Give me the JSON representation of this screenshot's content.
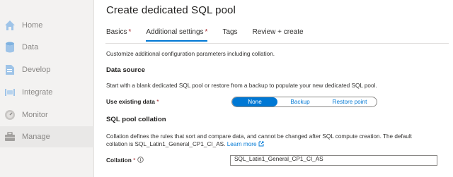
{
  "sidebar": {
    "items": [
      {
        "label": "Home",
        "icon": "home-icon"
      },
      {
        "label": "Data",
        "icon": "database-icon"
      },
      {
        "label": "Develop",
        "icon": "develop-icon"
      },
      {
        "label": "Integrate",
        "icon": "integrate-icon"
      },
      {
        "label": "Monitor",
        "icon": "monitor-icon"
      },
      {
        "label": "Manage",
        "icon": "toolbox-icon"
      }
    ],
    "active": "Manage"
  },
  "page": {
    "title": "Create dedicated SQL pool"
  },
  "tabs": [
    {
      "label": "Basics",
      "required": "*"
    },
    {
      "label": "Additional settings",
      "required": "*",
      "selected": true
    },
    {
      "label": "Tags",
      "required": ""
    },
    {
      "label": "Review + create",
      "required": ""
    }
  ],
  "content": {
    "intro": "Customize additional configuration parameters including collation.",
    "data_source_heading": "Data source",
    "data_source_desc": "Start with a blank dedicated SQL pool or restore from a backup to populate your new dedicated SQL pool.",
    "use_existing_label": "Use existing data",
    "required_mark": "*",
    "segments": [
      "None",
      "Backup",
      "Restore point"
    ],
    "selected_segment": "None",
    "collation_heading": "SQL pool collation",
    "collation_desc_1": "Collation defines the rules that sort and compare data, and cannot be changed after SQL compute creation. The default",
    "collation_desc_2": "collation is SQL_Latin1_General_CP1_CI_AS.",
    "learn_more": "Learn more",
    "collation_label": "Collation",
    "collation_value": "SQL_Latin1_General_CP1_CI_AS"
  },
  "colors": {
    "accent": "#0078d4",
    "required": "#a4262c",
    "sidebar_bg": "#f3f2f1"
  }
}
